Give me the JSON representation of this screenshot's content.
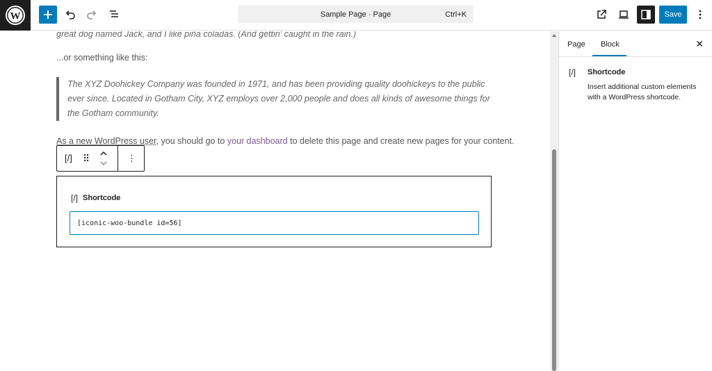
{
  "topbar": {
    "doc_title": "Sample Page · Page",
    "shortcut": "Ctrl+K",
    "save_label": "Save",
    "icons": [
      "wordpress-logo-icon",
      "plus-icon",
      "undo-icon",
      "redo-icon",
      "list-view-icon",
      "external-link-icon",
      "device-preview-icon",
      "settings-panel-icon",
      "more-vertical-icon"
    ]
  },
  "content": {
    "cut_line": "great dog named Jack, and I like piña coladas. (And gettin' caught in the rain.)",
    "or_line": "...or something like this:",
    "quote_text": "The XYZ Doohickey Company was founded in 1971, and has been providing quality doohickeys to the public ever since. Located in Gotham City, XYZ employs over 2,000 people and does all kinds of awesome things for the Gotham community.",
    "final_prefix": "As a new WordPress user",
    "final_mid": ", you should go to ",
    "final_link": "your dashboard",
    "final_suffix": " to delete this page and create new pages for your content."
  },
  "block_toolbar": {
    "shortcode_glyph": "[/]",
    "drag_glyph": "⠿",
    "more_glyph": "⋮"
  },
  "shortcode_block": {
    "label": "Shortcode",
    "glyph": "[/]",
    "value": "[iconic-woo-bundle id=56]"
  },
  "sidebar": {
    "tabs": [
      "Page",
      "Block"
    ],
    "active_tab": "Block",
    "close_glyph": "✕",
    "block_title": "Shortcode",
    "block_glyph": "[/]",
    "block_description": "Insert additional custom elements with a WordPress shortcode."
  },
  "colors": {
    "accent": "#007cba",
    "dark": "#1e1e1e",
    "link": "#7c5a8c"
  }
}
